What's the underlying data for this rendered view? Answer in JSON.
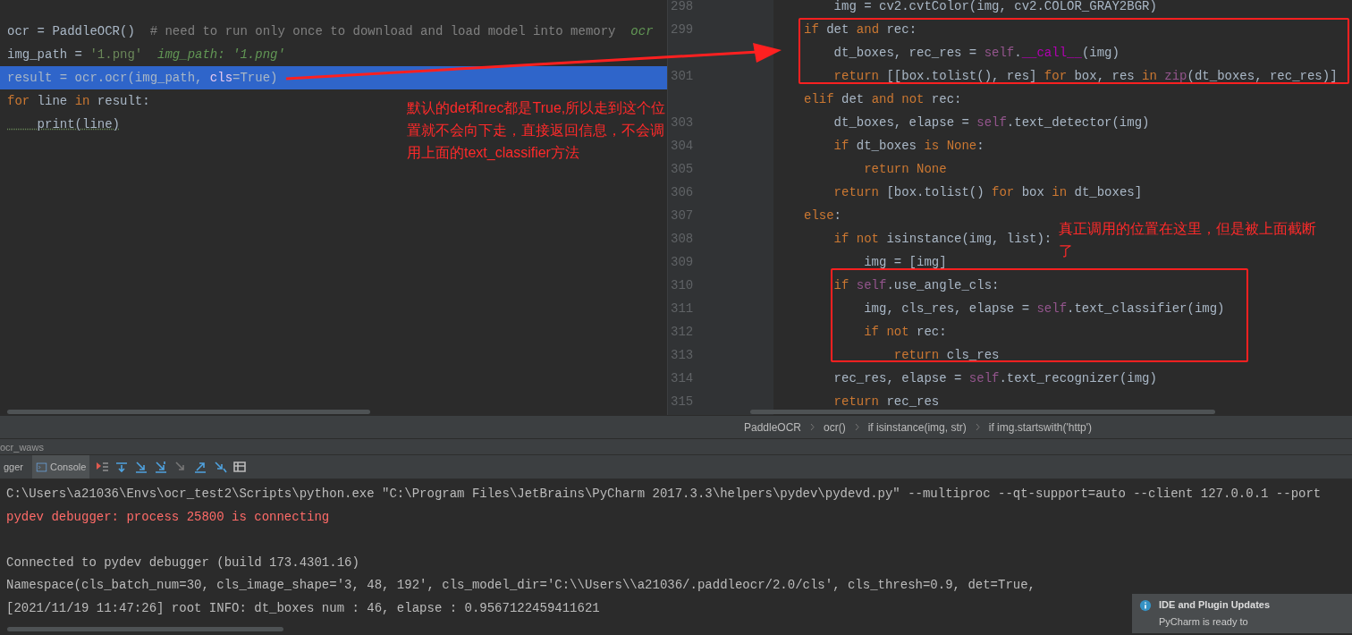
{
  "left_editor": {
    "lines": [
      {
        "highlighted": false,
        "tokens": [
          {
            "text": "ocr = PaddleOCR()  ",
            "kind": "plain"
          },
          {
            "text": "# need to run only once to download and load model into memory  ",
            "kind": "comment"
          },
          {
            "text": "ocr",
            "kind": "hint"
          }
        ]
      },
      {
        "highlighted": false,
        "tokens": [
          {
            "text": "img_path = ",
            "kind": "plain"
          },
          {
            "text": "'1.png'",
            "kind": "string"
          },
          {
            "text": "  img_path: '1.png'",
            "kind": "hint"
          }
        ]
      },
      {
        "highlighted": true,
        "tokens": [
          {
            "text": "result = ocr.ocr(img_path, ",
            "kind": "plain"
          },
          {
            "text": "cls",
            "kind": "param"
          },
          {
            "text": "=True)",
            "kind": "plain"
          }
        ]
      },
      {
        "highlighted": false,
        "tokens": [
          {
            "text": "for ",
            "kind": "keyword"
          },
          {
            "text": "line ",
            "kind": "plain"
          },
          {
            "text": "in ",
            "kind": "keyword"
          },
          {
            "text": "result:",
            "kind": "plain"
          }
        ]
      },
      {
        "highlighted": false,
        "tokens": [
          {
            "text": "    print(line)",
            "kind": "builtin"
          }
        ]
      }
    ]
  },
  "right_editor": {
    "lines": [
      {
        "number": "298",
        "tokens": [
          {
            "text": "    img = cv2.cvtColor(img, cv2.COLOR_GRAY2BGR)",
            "kind": "plain"
          }
        ]
      },
      {
        "number": "299",
        "tokens": [
          {
            "text": "if ",
            "kind": "keyword"
          },
          {
            "text": "det ",
            "kind": "plain"
          },
          {
            "text": "and ",
            "kind": "keyword"
          },
          {
            "text": "rec:",
            "kind": "plain"
          }
        ]
      },
      {
        "tokens": [
          {
            "text": "    dt_boxes, rec_res = ",
            "kind": "plain"
          },
          {
            "text": "self",
            "kind": "self"
          },
          {
            "text": ".",
            "kind": "plain"
          },
          {
            "text": "__call__",
            "kind": "magic"
          },
          {
            "text": "(img)",
            "kind": "plain"
          }
        ]
      },
      {
        "number": "301",
        "tokens": [
          {
            "text": "    return ",
            "kind": "keyword"
          },
          {
            "text": "[[box.tolist(), res] ",
            "kind": "plain"
          },
          {
            "text": "for ",
            "kind": "keyword"
          },
          {
            "text": "box, res ",
            "kind": "plain"
          },
          {
            "text": "in ",
            "kind": "keyword"
          },
          {
            "text": "zip",
            "kind": "self"
          },
          {
            "text": "(dt_boxes, rec_res)]",
            "kind": "plain"
          }
        ]
      },
      {
        "tokens": [
          {
            "text": "elif ",
            "kind": "keyword"
          },
          {
            "text": "det ",
            "kind": "plain"
          },
          {
            "text": "and not ",
            "kind": "keyword"
          },
          {
            "text": "rec:",
            "kind": "plain"
          }
        ]
      },
      {
        "number": "303",
        "tokens": [
          {
            "text": "    dt_boxes, elapse = ",
            "kind": "plain"
          },
          {
            "text": "self",
            "kind": "self"
          },
          {
            "text": ".text_detector(img)",
            "kind": "plain"
          }
        ]
      },
      {
        "number": "304",
        "tokens": [
          {
            "text": "    if ",
            "kind": "keyword"
          },
          {
            "text": "dt_boxes ",
            "kind": "plain"
          },
          {
            "text": "is None",
            "kind": "keyword"
          },
          {
            "text": ":",
            "kind": "plain"
          }
        ]
      },
      {
        "number": "305",
        "tokens": [
          {
            "text": "        return None",
            "kind": "keyword"
          }
        ]
      },
      {
        "number": "306",
        "tokens": [
          {
            "text": "    return ",
            "kind": "keyword"
          },
          {
            "text": "[box.tolist() ",
            "kind": "plain"
          },
          {
            "text": "for ",
            "kind": "keyword"
          },
          {
            "text": "box ",
            "kind": "plain"
          },
          {
            "text": "in ",
            "kind": "keyword"
          },
          {
            "text": "dt_boxes]",
            "kind": "plain"
          }
        ]
      },
      {
        "number": "307",
        "tokens": [
          {
            "text": "else",
            "kind": "keyword"
          },
          {
            "text": ":",
            "kind": "plain"
          }
        ]
      },
      {
        "number": "308",
        "tokens": [
          {
            "text": "    if not ",
            "kind": "keyword"
          },
          {
            "text": "isinstance(img, list):",
            "kind": "plain"
          }
        ]
      },
      {
        "number": "309",
        "tokens": [
          {
            "text": "        img = [img]",
            "kind": "plain"
          }
        ]
      },
      {
        "number": "310",
        "tokens": [
          {
            "text": "    if ",
            "kind": "keyword"
          },
          {
            "text": "self",
            "kind": "self"
          },
          {
            "text": ".use_angle_cls:",
            "kind": "plain"
          }
        ]
      },
      {
        "number": "311",
        "tokens": [
          {
            "text": "        img, cls_res, elapse = ",
            "kind": "plain"
          },
          {
            "text": "self",
            "kind": "self"
          },
          {
            "text": ".text_classifier(img)",
            "kind": "plain"
          }
        ]
      },
      {
        "number": "312",
        "tokens": [
          {
            "text": "        if not ",
            "kind": "keyword"
          },
          {
            "text": "rec:",
            "kind": "plain"
          }
        ]
      },
      {
        "number": "313",
        "tokens": [
          {
            "text": "            return ",
            "kind": "keyword"
          },
          {
            "text": "cls_res",
            "kind": "plain"
          }
        ]
      },
      {
        "number": "314",
        "tokens": [
          {
            "text": "    rec_res, elapse = ",
            "kind": "plain"
          },
          {
            "text": "self",
            "kind": "self"
          },
          {
            "text": ".text_recognizer(img)",
            "kind": "plain"
          }
        ]
      },
      {
        "number": "315",
        "tokens": [
          {
            "text": "    return ",
            "kind": "keyword"
          },
          {
            "text": "rec_res",
            "kind": "plain"
          }
        ]
      }
    ]
  },
  "breadcrumbs": [
    "PaddleOCR",
    "ocr()",
    "if isinstance(img, str)",
    "if img.startswith('http')"
  ],
  "annotations": {
    "note_left": "默认的det和rec都是True,所以走到这个位置就不会向下走，直接返回信息，不会调用上面的text_classifier方法",
    "note_right": "真正调用的位置在这里，但是被上面截断了"
  },
  "tool_window": {
    "title": "ocr_waws",
    "tabs": [
      {
        "label": "gger",
        "selected": false
      },
      {
        "label": "Console",
        "selected": true
      }
    ],
    "console": [
      {
        "kind": "normal",
        "text": "C:\\Users\\a21036\\Envs\\ocr_test2\\Scripts\\python.exe \"C:\\Program Files\\JetBrains\\PyCharm 2017.3.3\\helpers\\pydev\\pydevd.py\" --multiproc --qt-support=auto --client 127.0.0.1 --port"
      },
      {
        "kind": "error",
        "text": "pydev debugger: process 25800 is connecting"
      },
      {
        "kind": "blank"
      },
      {
        "kind": "normal",
        "text": "Connected to pydev debugger (build 173.4301.16)"
      },
      {
        "kind": "normal",
        "text": "Namespace(cls_batch_num=30, cls_image_shape='3, 48, 192', cls_model_dir='C:\\\\Users\\\\a21036/.paddleocr/2.0/cls', cls_thresh=0.9, det=True,"
      },
      {
        "kind": "normal",
        "text": "[2021/11/19 11:47:26] root INFO: dt_boxes num : 46, elapse : 0.9567122459411621"
      }
    ]
  },
  "notification": {
    "title": "IDE and Plugin Updates",
    "body": "PyCharm is ready to"
  }
}
